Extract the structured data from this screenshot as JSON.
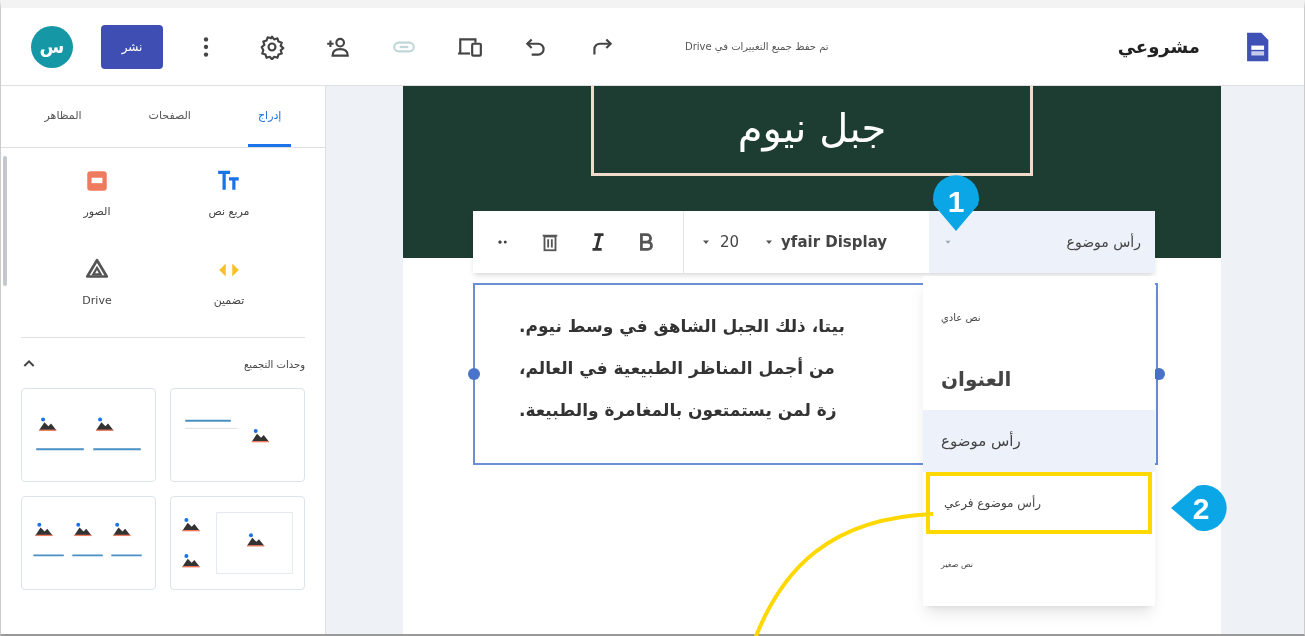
{
  "header": {
    "title": "مشروعي",
    "save_status": "تم حفظ جميع التغييرات في Drive",
    "publish_button": "نشر",
    "avatar_initial": "س",
    "tools": [
      {
        "kind": "more",
        "disabled": false
      },
      {
        "kind": "settings",
        "disabled": false
      },
      {
        "kind": "share",
        "disabled": false
      },
      {
        "kind": "link",
        "disabled": true
      },
      {
        "kind": "preview",
        "disabled": false
      },
      {
        "kind": "undo",
        "disabled": false
      },
      {
        "kind": "redo",
        "disabled": false
      }
    ]
  },
  "sidebar": {
    "tabs": [
      {
        "label": "إدراج",
        "selected": true
      },
      {
        "label": "الصفحات",
        "selected": false
      },
      {
        "label": "المظاهر",
        "selected": false
      }
    ],
    "insert_items": [
      {
        "kind": "text_box",
        "label": "مربع نص"
      },
      {
        "kind": "images",
        "label": "الصور"
      },
      {
        "kind": "embed",
        "label": "تضمين"
      },
      {
        "kind": "drive",
        "label": "Drive"
      }
    ],
    "section": {
      "title": "وحدات التجميع",
      "expanded": true
    }
  },
  "canvas": {
    "banner_title": "جبل نيوم",
    "toolbar": {
      "style": "رأس موضوع",
      "font": "yfair Display",
      "size": "20"
    },
    "text_lines": [
      "بيتا، ذلك الجبل الشاهق في وسط نيوم.",
      "من أجمل المناظر الطبيعية في العالم،",
      "زة لمن يستمتعون بالمغامرة والطبيعة."
    ],
    "style_menu": [
      {
        "kind": "normal",
        "label": "نص عادي",
        "selected": false,
        "highlighted": false
      },
      {
        "kind": "title",
        "label": "العنوان",
        "selected": false,
        "highlighted": false
      },
      {
        "kind": "heading",
        "label": "رأس موضوع",
        "selected": true,
        "highlighted": false
      },
      {
        "kind": "subheading",
        "label": "رأس موضوع فرعي",
        "selected": false,
        "highlighted": true
      },
      {
        "kind": "small",
        "label": "نص صغير",
        "selected": false,
        "highlighted": false
      }
    ]
  },
  "callouts": [
    {
      "number": "1"
    },
    {
      "number": "2"
    }
  ]
}
